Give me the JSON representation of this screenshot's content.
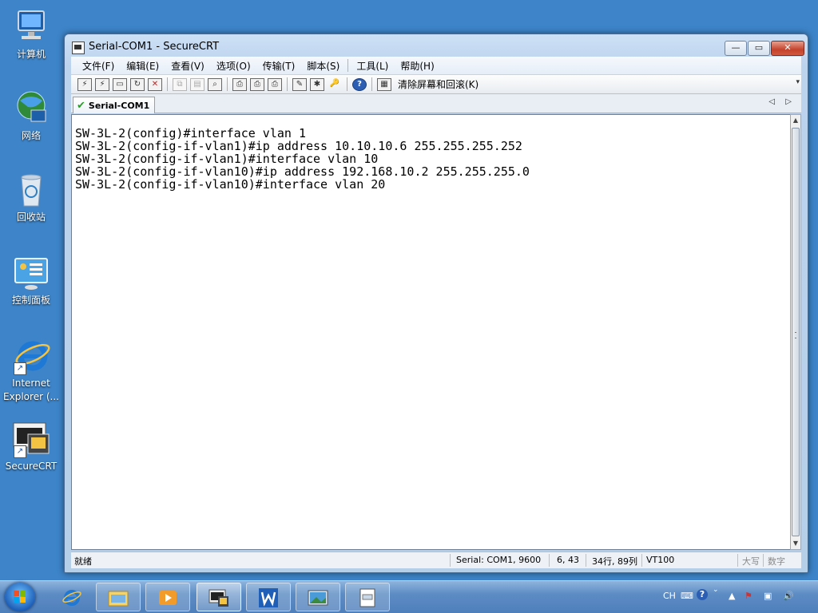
{
  "desktop": {
    "icons": [
      {
        "label": "计算机"
      },
      {
        "label": "网络"
      },
      {
        "label": "回收站"
      },
      {
        "label": "控制面板"
      },
      {
        "label": "Internet\nExplorer (..."
      },
      {
        "label": "SecureCRT"
      }
    ]
  },
  "window": {
    "title": "Serial-COM1 - SecureCRT",
    "controls": {
      "minimize": "—",
      "maximize": "▭",
      "close": "✕"
    }
  },
  "menu": {
    "items": [
      "文件(F)",
      "编辑(E)",
      "查看(V)",
      "选项(O)",
      "传输(T)",
      "脚本(S)",
      "工具(L)",
      "帮助(H)"
    ]
  },
  "toolbar": {
    "clear_label": "清除屏幕和回滚(K)",
    "help_glyph": "?"
  },
  "tabs": {
    "active": "Serial-COM1",
    "prev_glyph": "◁",
    "next_glyph": "▷"
  },
  "terminal": {
    "lines": [
      "SW-3L-2(config)#interface vlan 1",
      "SW-3L-2(config-if-vlan1)#ip address 10.10.10.6 255.255.255.252",
      "SW-3L-2(config-if-vlan1)#interface vlan 10",
      "SW-3L-2(config-if-vlan10)#ip address 192.168.10.2 255.255.255.0",
      "SW-3L-2(config-if-vlan10)#interface vlan 20"
    ]
  },
  "statusbar": {
    "ready": "就绪",
    "connection": "Serial: COM1, 9600",
    "cursor": "6, 43",
    "size": "34行, 89列",
    "emulation": "VT100",
    "caps": "大写",
    "num": "数字"
  },
  "taskbar": {
    "tray_lang": "CH",
    "colors": {
      "accent": "#3d84c8"
    }
  }
}
